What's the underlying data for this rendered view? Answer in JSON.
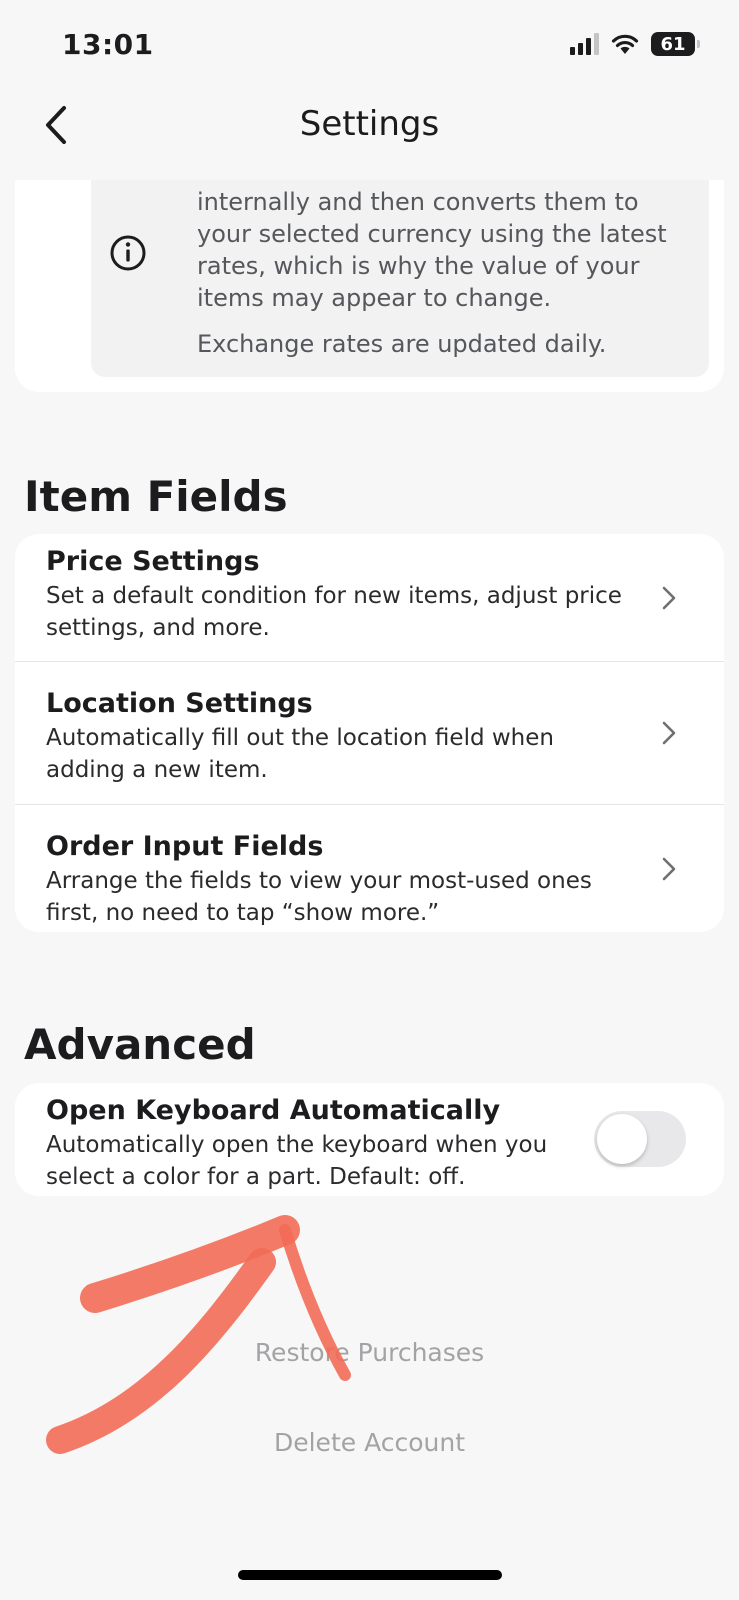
{
  "status_bar": {
    "time": "13:01",
    "battery": "61"
  },
  "nav": {
    "title": "Settings"
  },
  "currency_info": {
    "text": "internally and then converts them to your selected currency using the latest rates, which is why the value of your items may appear to change.",
    "note": "Exchange rates are updated daily."
  },
  "item_fields": {
    "title": "Item Fields",
    "rows": [
      {
        "title": "Price Settings",
        "description": "Set a default condition for new items, adjust price settings, and more."
      },
      {
        "title": "Location Settings",
        "description": "Automatically fill out the location field when adding a new item."
      },
      {
        "title": "Order Input Fields",
        "description": "Arrange the fields to view your most-used ones first, no need to tap “show more.”"
      }
    ]
  },
  "advanced": {
    "title": "Advanced",
    "keyboard": {
      "title": "Open Keyboard Automatically",
      "description": "Automatically open the keyboard when you select a color for a part. Default: off.",
      "enabled": false
    }
  },
  "links": {
    "restore": "Restore Purchases",
    "delete": "Delete Account"
  },
  "colors": {
    "annotation": "#f26b55",
    "toggle_off": "#e8e8ea",
    "link": "#a3a3a6"
  }
}
